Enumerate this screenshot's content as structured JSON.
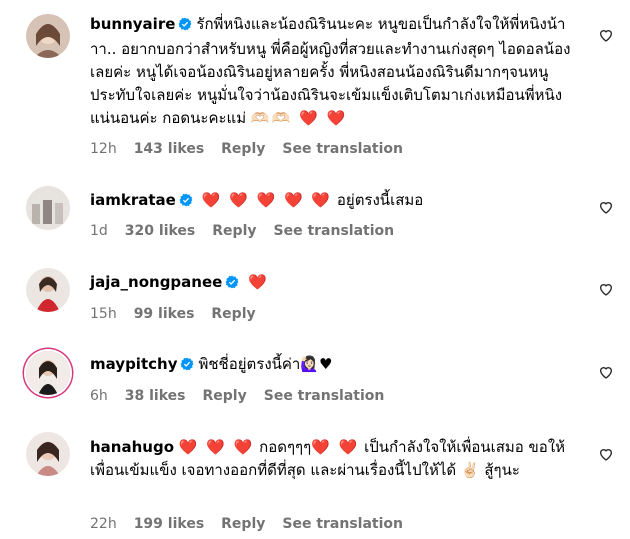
{
  "comments": [
    {
      "username": "bunnyaire",
      "text": "รักพี่หนิงและน้องณิรินนะคะ หนูขอเป็นกำลังใจให้พี่หนิงน้าาา.. อยากบอกว่าสำหรับหนู พี่คือผู้หญิงที่สวยและทำงานเก่งสุดๆ ไอดอลน้องเลยค่ะ หนูได้เจอน้องณิรินอยู่หลายครั้ง พี่หนิงสอนน้องณิรินดีมากๆจนหนูประทับใจเลยค่ะ หนูมั่นใจว่าน้องณิรินจะเข้มแข็งเติบโตมาเก่งเหมือนพี่หนิงแน่นอนค่ะ กอดนะคะแม่",
      "emoji": "🫶🏻🫶🏻 ❤️ ❤️",
      "time": "12h",
      "likes": "143 likes",
      "reply": "Reply",
      "translation": "See translation"
    },
    {
      "username": "iamkratae",
      "text": "อยู่ตรงนี้เสมอ",
      "emoji": "❤️ ❤️ ❤️ ❤️ ❤️",
      "time": "1d",
      "likes": "320 likes",
      "reply": "Reply",
      "translation": "See translation"
    },
    {
      "username": "jaja_nongpanee",
      "text": "",
      "emoji": "❤️",
      "time": "15h",
      "likes": "99 likes",
      "reply": "Reply"
    },
    {
      "username": "maypitchy",
      "text": "พิชชี่อยู่ตรงนี้ค่า",
      "emoji": "🙋🏻‍♀️♥",
      "time": "6h",
      "likes": "38 likes",
      "reply": "Reply",
      "translation": "See translation"
    },
    {
      "username": "hanahugo",
      "text_a": "กอดๆๆๆ",
      "text_b": "เป็นกำลังใจให้เพื่อนเสมอ ขอให้เพื่อนเข้มแข็ง เจอทางออกที่ดีที่สุด และผ่านเรื่องนี้ไปให้ได้",
      "text_c": "สู้ๆนะ",
      "emoji_a": "❤️ ❤️ ❤️",
      "emoji_b": "❤️ ❤️",
      "emoji_c": "✌🏻",
      "time": "22h",
      "likes": "199 likes",
      "reply": "Reply",
      "translation": "See translation"
    }
  ],
  "colors": {
    "verified": "#0095f6",
    "heart": "#e0245e",
    "meta": "#737373"
  },
  "icons": {
    "verified": "verified-badge-icon",
    "like": "heart-outline-icon"
  }
}
